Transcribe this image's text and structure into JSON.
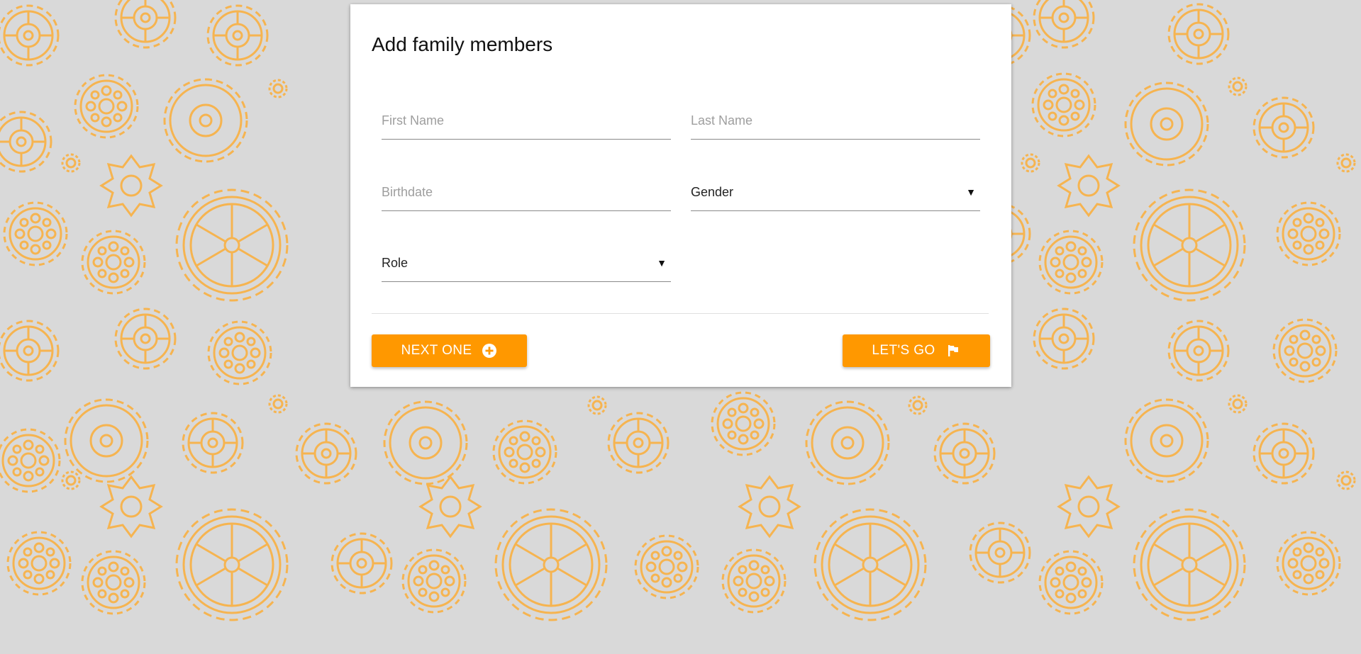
{
  "theme": {
    "page_background": "#d9d9d9",
    "pattern_color": "#f6b450",
    "card_background": "#ffffff",
    "accent": "#ff9800",
    "button_text": "#ffffff"
  },
  "background": {
    "pattern": "gear-icon"
  },
  "form": {
    "title": "Add family members",
    "first_name": {
      "placeholder": "First Name",
      "value": ""
    },
    "last_name": {
      "placeholder": "Last Name",
      "value": ""
    },
    "birthdate": {
      "placeholder": "Birthdate",
      "value": ""
    },
    "gender": {
      "selected": "Gender",
      "icon": "caret-down-icon"
    },
    "role": {
      "selected": "Role",
      "icon": "caret-down-icon"
    }
  },
  "actions": {
    "next_one_label": "NEXT ONE",
    "next_one_icon": "plus-circle-icon",
    "lets_go_label": "LET'S GO",
    "lets_go_icon": "flag-icon"
  }
}
